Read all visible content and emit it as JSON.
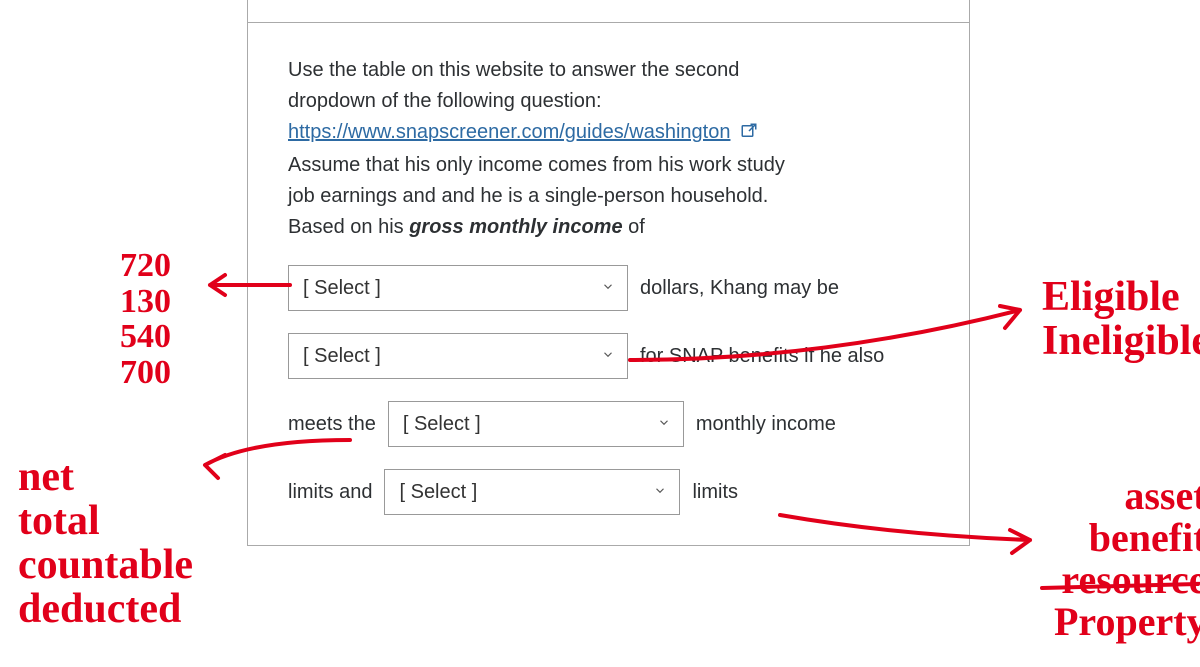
{
  "question": {
    "intro_line1": "Use the table on this website to answer the second",
    "intro_line2": "dropdown of the following question:",
    "link_text": "https://www.snapscreener.com/guides/washington",
    "link_href": "https://www.snapscreener.com/guides/washington",
    "assume_line1": "Assume that his only income comes from his work study",
    "assume_line2": "job earnings and and he is a single-person household.",
    "based_on_prefix": "Based on his ",
    "based_on_bold": "gross monthly income",
    "based_on_suffix": " of",
    "select_placeholder": "[ Select ]",
    "text_after_select1": "dollars, Khang may be",
    "text_after_select2": "for SNAP benefits if he also",
    "meets_the": "meets the",
    "monthly_income": "monthly income",
    "limits_and": "limits and",
    "limits": "limits"
  },
  "annotations": {
    "left_numbers": "720\n130\n540\n700",
    "left_words": "net\ntotal\ncountable\ndeducted",
    "right_top": "Eligible\nIneligible",
    "right_bottom": "asset\nbenefit\nresource\nProperty"
  }
}
